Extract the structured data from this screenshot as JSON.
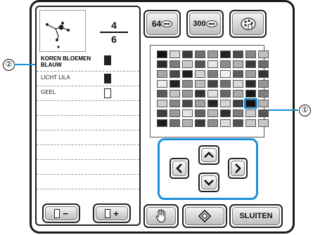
{
  "counter": {
    "current": "4",
    "total": "6"
  },
  "threads": [
    {
      "name": "KOREN BLOEMEN BLAUW",
      "state": "full",
      "selected": true
    },
    {
      "name": "LICHT LILA",
      "state": "full",
      "selected": false
    },
    {
      "name": "GEEL",
      "state": "empty",
      "selected": false
    },
    {
      "name": "",
      "state": "none",
      "selected": false
    },
    {
      "name": "",
      "state": "none",
      "selected": false
    },
    {
      "name": "",
      "state": "none",
      "selected": false
    },
    {
      "name": "",
      "state": "none",
      "selected": false
    },
    {
      "name": "",
      "state": "none",
      "selected": false
    },
    {
      "name": "",
      "state": "none",
      "selected": false
    }
  ],
  "top_buttons": {
    "palette64": {
      "label": "64",
      "icon": "spool-set-icon"
    },
    "palette300": {
      "label": "300",
      "icon": "spool-set-icon"
    },
    "user_palette": {
      "icon": "user-thread-palette-icon"
    }
  },
  "bottom_buttons": {
    "spool_minus": "−",
    "spool_plus": "+",
    "hand": "hand-icon",
    "diamond": "diamond-icon",
    "close": "SLUITEN"
  },
  "callouts": {
    "one": "①",
    "two": "②"
  },
  "palette": {
    "rows": [
      [
        "#111111",
        "#d8d8d8",
        "#3a3a3a",
        "#6f6f6f",
        "#9b9b9b",
        "#222222",
        "#4d4d4d",
        "#888888",
        "#c2c2c2"
      ],
      [
        "#2e2e2e",
        "#7a7a7a",
        "#c9c9c9",
        "#555555",
        "#e6e6e6",
        "#8c8c8c",
        "#b0b0b0",
        "#3c3c3c",
        "#6b6b6b"
      ],
      [
        "#a6a6a6",
        "#4a4a4a",
        "#1f1f1f",
        "#d0d0d0",
        "#7c7c7c",
        "#f0f0f0",
        "#5c5c5c",
        "#9e9e9e",
        "#363636"
      ],
      [
        "#ededed",
        "#232323",
        "#8a8a8a",
        "#bdbdbd",
        "#444444",
        "#707070",
        "#d9d9d9",
        "#2b2b2b",
        "#959595"
      ],
      [
        "#5a5a5a",
        "#c4c4c4",
        "#999999",
        "#333333",
        "#e0e0e0",
        "#666666",
        "#ababab",
        "#1a1a1a",
        "#7f7f7f"
      ],
      [
        "#cfcfcf",
        "#868686",
        "#474747",
        "#a0a0a0",
        "#262626",
        "#d4d4d4",
        "#3f3f3f",
        "#111111",
        "#b5b5b5"
      ],
      [
        "#404040",
        "#9a9a9a",
        "#e4e4e4",
        "#616161",
        "#b8b8b8",
        "#2f2f2f",
        "#7d7d7d",
        "#cdcdcd",
        "#555555"
      ],
      [
        "#1d1d1d",
        "#6e6e6e",
        "#b2b2b2",
        "#3b3b3b",
        "#8f8f8f",
        "#dcdcdc",
        "#4f4f4f",
        "#c7c7c7",
        "#c7c7c7"
      ]
    ],
    "selected": {
      "row": 5,
      "col": 7
    },
    "selection_color": "#1b8fdc"
  },
  "accent": "#1b8fdc"
}
